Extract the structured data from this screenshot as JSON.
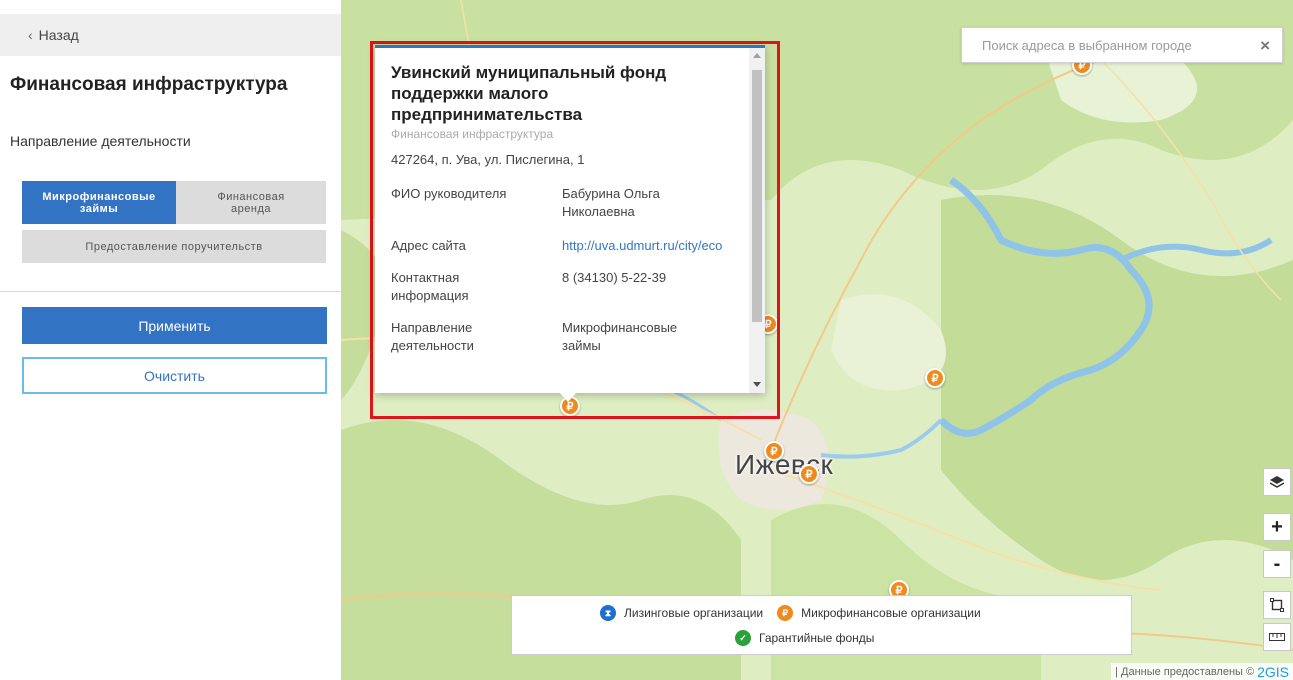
{
  "sidebar": {
    "back_label": "Назад",
    "title": "Финансовая инфраструктура",
    "subtitle": "Направление деятельности",
    "filters": {
      "microloans": "Микрофинансовые займы",
      "finance_rent": "Финансовая аренда",
      "guarantees": "Предоставление поручительств"
    },
    "apply_label": "Применить",
    "clear_label": "Очистить"
  },
  "map": {
    "search_placeholder": "Поиск адреса в выбранном городе",
    "city_label": "Ижевск",
    "marker_glyph": "₽",
    "zoom_in": "+",
    "zoom_out": "-",
    "attribution_text": "| Данные предоставлены ©",
    "attribution_brand": "2GIS"
  },
  "popup": {
    "title": "Увинский муниципальный фонд поддержки малого предпринимательства",
    "category": "Финансовая инфраструктура",
    "address": "427264, п. Ува, ул. Пислегина, 1",
    "rows": [
      {
        "key": "ФИО руководителя",
        "value": "Бабурина Ольга Николаевна"
      },
      {
        "key": "Адрес сайта",
        "value": "http://uva.udmurt.ru/city/eco"
      },
      {
        "key": "Контактная информация",
        "value": "8 (34130) 5-22-39"
      },
      {
        "key": "Направление деятельности",
        "value": "Микрофинансовые займы"
      }
    ]
  },
  "legend": {
    "leasing": "Лизинговые организации",
    "microfinance": "Микрофинансовые организации",
    "guarantee_funds": "Гарантийные фонды",
    "colors": {
      "leasing": "#1f6fd0",
      "microfinance": "#ef8a1d",
      "guarantee_funds": "#2aa13a"
    }
  },
  "colors": {
    "accent": "#3373c4",
    "highlight_frame": "#e0141a",
    "marker": "#ef8a1d"
  }
}
